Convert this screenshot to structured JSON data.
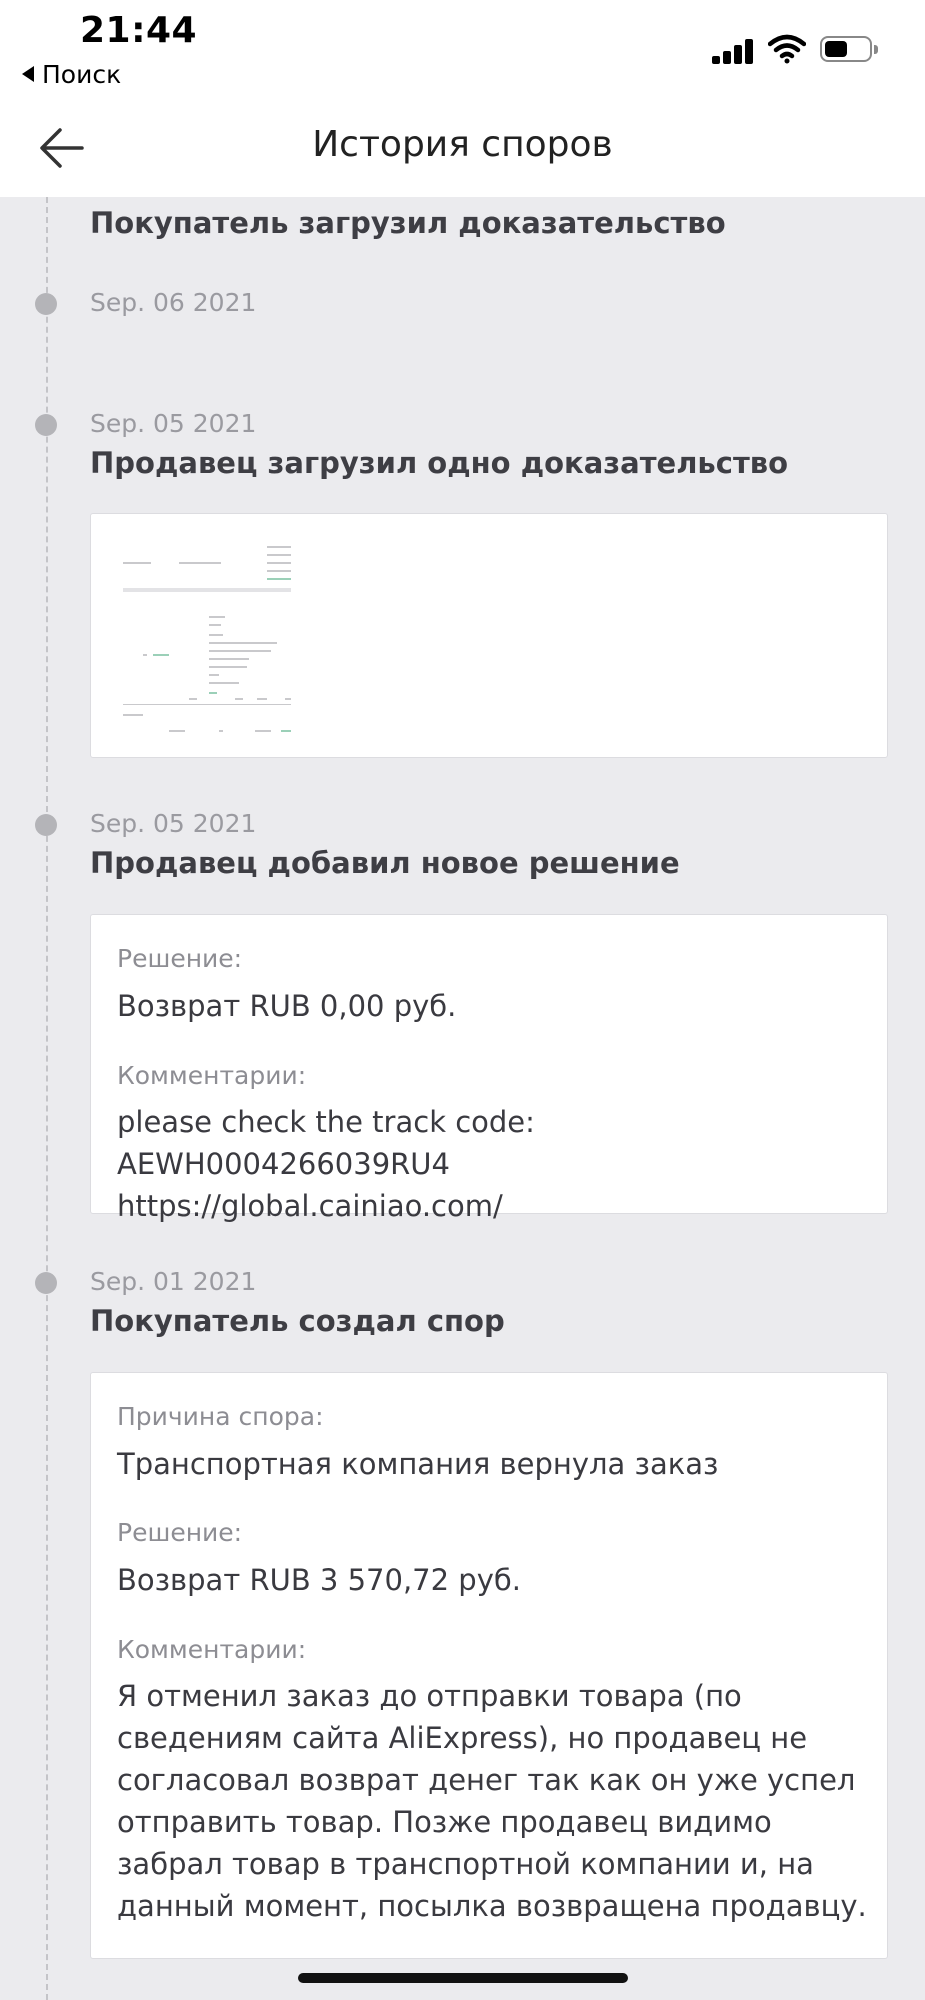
{
  "status_bar": {
    "time": "21:44",
    "back_app_label": "Поиск",
    "signal_icon": "cellular-signal-icon",
    "wifi_icon": "wifi-icon",
    "battery_icon": "battery-icon"
  },
  "header": {
    "back_icon": "arrow-left-icon",
    "title": "История споров"
  },
  "events": [
    {
      "date": "",
      "title": "Покупатель загрузил доказательство"
    },
    {
      "date": "Sep. 06 2021",
      "title": ""
    },
    {
      "date": "Sep. 05 2021",
      "title": "Продавец загрузил одно доказательство",
      "attachment": "document-thumbnail"
    },
    {
      "date": "Sep. 05 2021",
      "title": "Продавец добавил новое решение",
      "fields": [
        {
          "label": "Решение:",
          "value": "Возврат RUB 0,00 руб."
        },
        {
          "label": "Комментарии:",
          "value_lines": [
            "please check the track code: AEWH0004266039RU4",
            "https://global.cainiao.com/"
          ]
        }
      ]
    },
    {
      "date": "Sep. 01 2021",
      "title": "Покупатель создал спор",
      "fields": [
        {
          "label": "Причина спора:",
          "value": "Транспортная компания вернула заказ"
        },
        {
          "label": "Решение:",
          "value": "Возврат RUB 3 570,72 руб."
        },
        {
          "label": "Комментарии:",
          "value_lines": [
            "Я отменил заказ до отправки товара (по",
            "сведениям сайта AliExpress), но продавец не",
            "согласовал возврат денег так как он уже успел",
            "отправить товар. Позже продавец видимо",
            "забрал товар в транспортной компании и, на",
            "данный момент, посылка возвращена продавцу."
          ]
        }
      ]
    }
  ],
  "colors": {
    "background": "#ebebee",
    "card": "#ffffff",
    "timeline_dot": "#b4b4b8",
    "date_text": "#9a9aa0",
    "title_text": "#3e3e44"
  }
}
